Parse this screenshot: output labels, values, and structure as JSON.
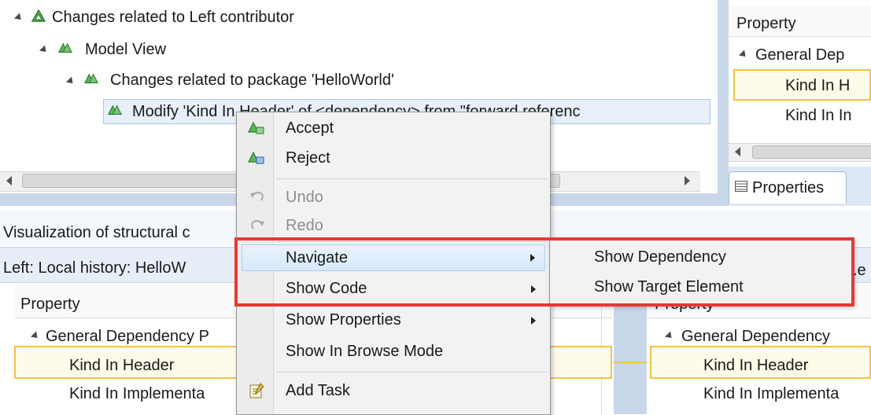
{
  "tree": {
    "root_label": "Changes related to Left contributor",
    "model_view_label": "Model View",
    "package_label": "Changes related to package 'HelloWorld'",
    "diff_label": "Modify 'Kind In Header' of <dependency> from \"forward referenc"
  },
  "properties_top": {
    "column_header": "Property",
    "group_label": "General Dep",
    "row1_label": "Kind In H",
    "row2_label": "Kind In In",
    "tab_label": "Properties"
  },
  "visualization": {
    "title": "Visualization of structural c",
    "left_header": "Left: Local history: HelloW",
    "right_header_fragment": ".e"
  },
  "left_properties": {
    "column_header": "Property",
    "group_label": "General Dependency P",
    "row1_label": "Kind In Header",
    "row2_label": "Kind In Implementa"
  },
  "right_properties": {
    "column_header": "Property",
    "group_label": "General Dependency",
    "row1_label": "Kind In Header",
    "row2_label": "Kind In Implementa"
  },
  "context_menu": {
    "accept": "Accept",
    "reject": "Reject",
    "undo": "Undo",
    "redo": "Redo",
    "navigate": "Navigate",
    "show_code": "Show Code",
    "show_properties": "Show Properties",
    "show_in_browse_mode": "Show In Browse Mode",
    "add_task": "Add Task"
  },
  "submenu": {
    "show_dependency": "Show Dependency",
    "show_target_element": "Show Target Element"
  },
  "colors": {
    "highlight_box": "#e53935",
    "selection_border": "#f3c24a",
    "model_icon_green": "#3a9a3a"
  }
}
